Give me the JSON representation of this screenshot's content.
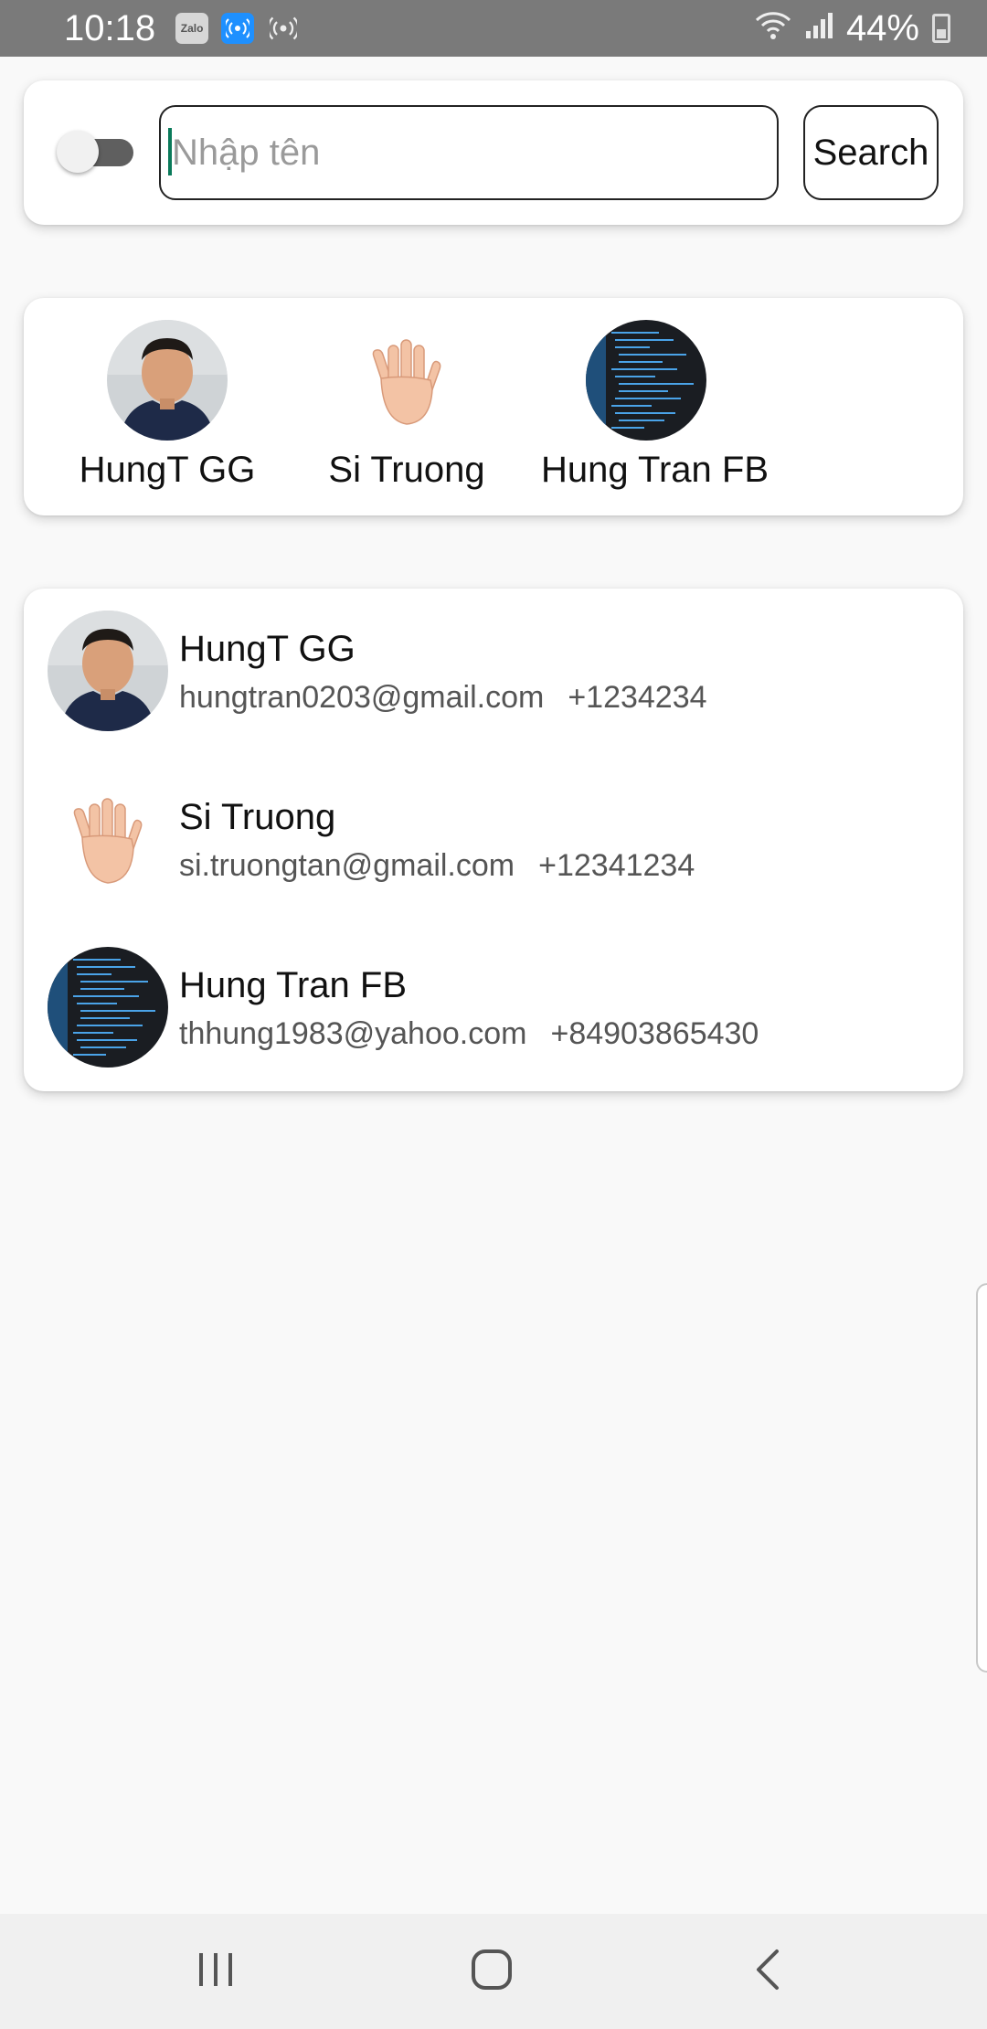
{
  "status_bar": {
    "time": "10:18",
    "zalo_label": "Zalo",
    "battery": "44%",
    "icons": [
      "zalo-icon",
      "hotspot-icon",
      "hotspot-icon",
      "wifi-icon",
      "signal-icon",
      "battery-icon"
    ]
  },
  "search": {
    "toggle_on": false,
    "placeholder": "Nhập tên",
    "value": "",
    "button_label": "Search"
  },
  "favorites": [
    {
      "name": "HungT GG",
      "avatar": "person-photo"
    },
    {
      "name": "Si Truong",
      "avatar": "hand-icon"
    },
    {
      "name": "Hung Tran FB",
      "avatar": "code-screenshot"
    }
  ],
  "contacts": [
    {
      "name": "HungT GG",
      "email": "hungtran0203@gmail.com",
      "phone": "+1234234",
      "avatar": "person-photo"
    },
    {
      "name": "Si Truong",
      "email": "si.truongtan@gmail.com",
      "phone": "+12341234",
      "avatar": "hand-icon"
    },
    {
      "name": "Hung Tran FB",
      "email": "thhung1983@yahoo.com",
      "phone": "+84903865430",
      "avatar": "code-screenshot"
    }
  ],
  "nav_bar": {
    "buttons": [
      "recent-apps-icon",
      "home-icon",
      "back-icon"
    ]
  },
  "colors": {
    "status_bar": "#7a7a7a",
    "background": "#f9f9f9",
    "card": "#ffffff",
    "caret": "#0a7a5a"
  }
}
